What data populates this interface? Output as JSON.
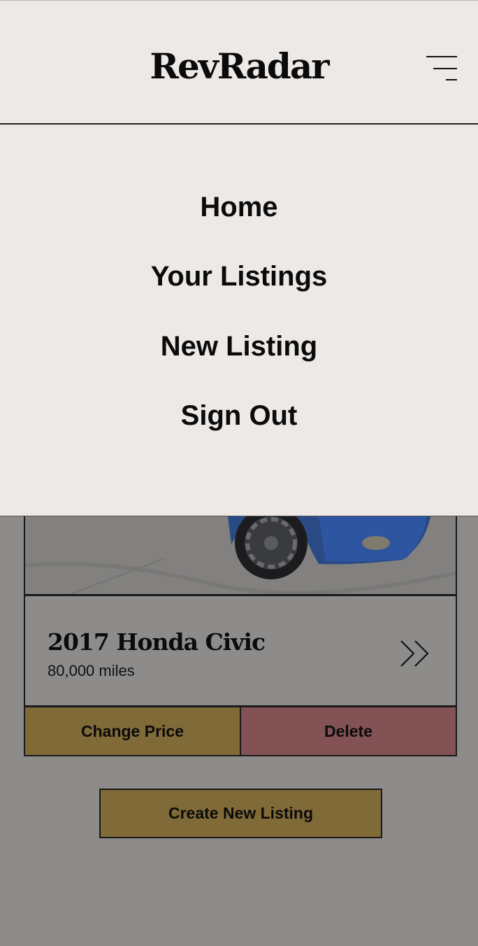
{
  "header": {
    "logo_text": "RevRadar",
    "menu_icon": "hamburger-menu-icon"
  },
  "menu": {
    "items": [
      {
        "label": "Home"
      },
      {
        "label": "Your Listings"
      },
      {
        "label": "New Listing"
      },
      {
        "label": "Sign Out"
      }
    ]
  },
  "listing": {
    "title": "2017 Honda Civic",
    "mileage": "80,000 miles",
    "car_color": "#1e4fb4",
    "details_icon": "double-chevron-right-icon",
    "change_price_label": "Change Price",
    "delete_label": "Delete"
  },
  "create_listing_label": "Create New Listing",
  "colors": {
    "background": "#ece9e6",
    "overlay": "#8d8c8a",
    "primary_button": "#806a38",
    "delete_button": "#835254"
  }
}
